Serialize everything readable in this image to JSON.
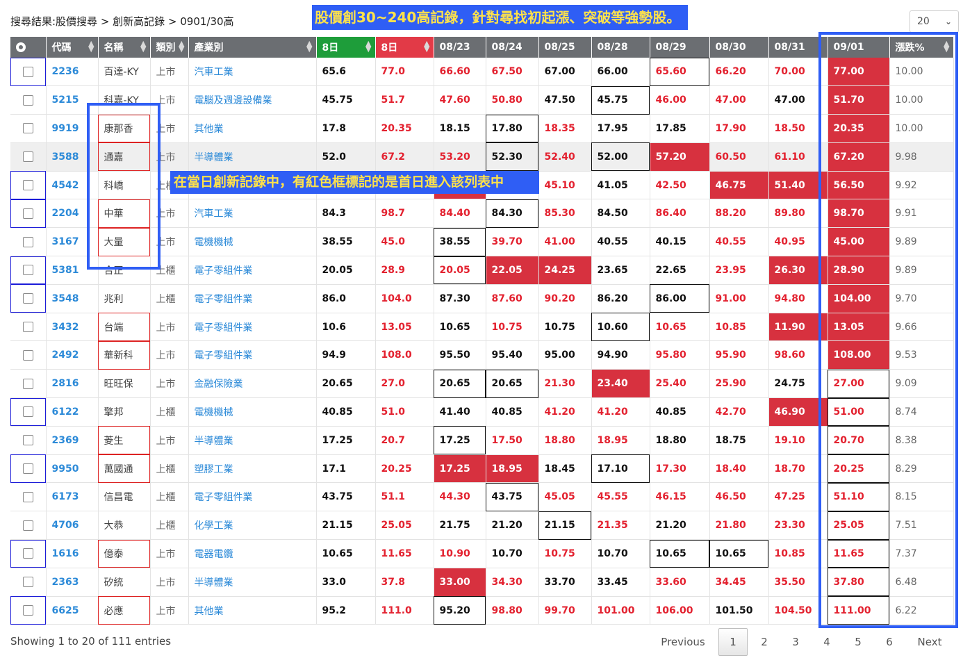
{
  "breadcrumb": "搜尋結果:股價搜尋 > 創新高記錄 > 0901/30高",
  "banner": "股價創30~240高記錄，針對尋找初起漲、突破等強勢股。",
  "callout": "在當日創新記錄中，有紅色框標記的是首日進入該列表中",
  "page_size": "20",
  "headers": [
    "代碼",
    "名稱",
    "類別",
    "產業別",
    "8日",
    "8日",
    "08/23",
    "08/24",
    "08/25",
    "08/28",
    "08/29",
    "08/30",
    "08/31",
    "09/01",
    "漲跌%"
  ],
  "rows": [
    {
      "code": "2236",
      "name": "百達-KY",
      "mkt": "上市",
      "ind": "汽車工業",
      "low": "65.6",
      "high": "77.0",
      "d": [
        "66.60",
        "67.50",
        "67.00",
        "66.00",
        "65.60",
        "66.20",
        "70.00",
        "77.00"
      ],
      "pct": "10.00"
    },
    {
      "code": "5215",
      "name": "科嘉-KY",
      "mkt": "上市",
      "ind": "電腦及週邊設備業",
      "low": "45.75",
      "high": "51.7",
      "d": [
        "47.60",
        "50.80",
        "47.50",
        "45.75",
        "46.00",
        "47.00",
        "47.00",
        "51.70"
      ],
      "pct": "10.00"
    },
    {
      "code": "9919",
      "name": "康那香",
      "mkt": "上市",
      "ind": "其他業",
      "low": "17.8",
      "high": "20.35",
      "d": [
        "18.15",
        "17.80",
        "18.35",
        "17.95",
        "17.85",
        "17.90",
        "18.50",
        "20.35"
      ],
      "pct": "10.00"
    },
    {
      "code": "3588",
      "name": "通嘉",
      "mkt": "上市",
      "ind": "半導體業",
      "low": "52.0",
      "high": "67.2",
      "d": [
        "53.20",
        "52.30",
        "52.40",
        "52.00",
        "57.20",
        "60.50",
        "61.10",
        "67.20"
      ],
      "pct": "9.98"
    },
    {
      "code": "4542",
      "name": "科嶠",
      "mkt": "上櫃",
      "ind": "",
      "low": "",
      "high": "",
      "d": [
        "",
        "",
        "45.10",
        "41.05",
        "42.50",
        "46.75",
        "51.40",
        "56.50"
      ],
      "pct": "9.92"
    },
    {
      "code": "2204",
      "name": "中華",
      "mkt": "上市",
      "ind": "汽車工業",
      "low": "84.3",
      "high": "98.7",
      "d": [
        "84.40",
        "84.30",
        "85.30",
        "84.50",
        "86.40",
        "88.20",
        "89.80",
        "98.70"
      ],
      "pct": "9.91"
    },
    {
      "code": "3167",
      "name": "大量",
      "mkt": "上市",
      "ind": "電機機械",
      "low": "38.55",
      "high": "45.0",
      "d": [
        "38.55",
        "39.70",
        "41.00",
        "40.55",
        "40.15",
        "40.55",
        "40.95",
        "45.00"
      ],
      "pct": "9.89"
    },
    {
      "code": "5381",
      "name": "合正",
      "mkt": "上櫃",
      "ind": "電子零組件業",
      "low": "20.05",
      "high": "28.9",
      "d": [
        "20.05",
        "22.05",
        "24.25",
        "23.65",
        "22.65",
        "23.95",
        "26.30",
        "28.90"
      ],
      "pct": "9.89"
    },
    {
      "code": "3548",
      "name": "兆利",
      "mkt": "上櫃",
      "ind": "電子零組件業",
      "low": "86.0",
      "high": "104.0",
      "d": [
        "87.30",
        "87.60",
        "90.20",
        "86.20",
        "86.00",
        "91.00",
        "94.80",
        "104.00"
      ],
      "pct": "9.70"
    },
    {
      "code": "3432",
      "name": "台端",
      "mkt": "上市",
      "ind": "電子零組件業",
      "low": "10.6",
      "high": "13.05",
      "d": [
        "10.65",
        "10.75",
        "10.75",
        "10.60",
        "10.65",
        "10.85",
        "11.90",
        "13.05"
      ],
      "pct": "9.66"
    },
    {
      "code": "2492",
      "name": "華新科",
      "mkt": "上市",
      "ind": "電子零組件業",
      "low": "94.9",
      "high": "108.0",
      "d": [
        "95.50",
        "95.40",
        "95.00",
        "94.90",
        "95.80",
        "95.90",
        "98.60",
        "108.00"
      ],
      "pct": "9.53"
    },
    {
      "code": "2816",
      "name": "旺旺保",
      "mkt": "上市",
      "ind": "金融保險業",
      "low": "20.65",
      "high": "27.0",
      "d": [
        "20.65",
        "20.65",
        "21.30",
        "23.40",
        "25.40",
        "25.90",
        "24.75",
        "27.00"
      ],
      "pct": "9.09"
    },
    {
      "code": "6122",
      "name": "擎邦",
      "mkt": "上櫃",
      "ind": "電機機械",
      "low": "40.85",
      "high": "51.0",
      "d": [
        "41.40",
        "40.85",
        "41.20",
        "41.20",
        "40.85",
        "42.70",
        "46.90",
        "51.00"
      ],
      "pct": "8.74"
    },
    {
      "code": "2369",
      "name": "菱生",
      "mkt": "上市",
      "ind": "半導體業",
      "low": "17.25",
      "high": "20.7",
      "d": [
        "17.25",
        "17.50",
        "18.80",
        "18.95",
        "18.80",
        "18.75",
        "19.10",
        "20.70"
      ],
      "pct": "8.38"
    },
    {
      "code": "9950",
      "name": "萬國通",
      "mkt": "上櫃",
      "ind": "塑膠工業",
      "low": "17.1",
      "high": "20.25",
      "d": [
        "17.25",
        "18.95",
        "18.45",
        "17.10",
        "17.30",
        "18.40",
        "18.70",
        "20.25"
      ],
      "pct": "8.29"
    },
    {
      "code": "6173",
      "name": "信昌電",
      "mkt": "上櫃",
      "ind": "電子零組件業",
      "low": "43.75",
      "high": "51.1",
      "d": [
        "44.30",
        "43.75",
        "45.05",
        "45.55",
        "46.15",
        "46.50",
        "47.25",
        "51.10"
      ],
      "pct": "8.15"
    },
    {
      "code": "4706",
      "name": "大恭",
      "mkt": "上櫃",
      "ind": "化學工業",
      "low": "21.15",
      "high": "25.05",
      "d": [
        "21.75",
        "21.20",
        "21.15",
        "21.35",
        "21.20",
        "21.80",
        "23.30",
        "25.05"
      ],
      "pct": "7.51"
    },
    {
      "code": "1616",
      "name": "億泰",
      "mkt": "上市",
      "ind": "電器電纜",
      "low": "10.65",
      "high": "11.65",
      "d": [
        "10.90",
        "10.70",
        "10.75",
        "10.70",
        "10.65",
        "10.65",
        "10.85",
        "11.65"
      ],
      "pct": "7.37"
    },
    {
      "code": "2363",
      "name": "矽統",
      "mkt": "上市",
      "ind": "半導體業",
      "low": "33.0",
      "high": "37.8",
      "d": [
        "33.00",
        "34.30",
        "33.70",
        "33.45",
        "33.60",
        "34.45",
        "35.50",
        "37.80"
      ],
      "pct": "6.48"
    },
    {
      "code": "6625",
      "name": "必應",
      "mkt": "上市",
      "ind": "其他業",
      "low": "95.2",
      "high": "111.0",
      "d": [
        "95.20",
        "98.80",
        "99.70",
        "101.00",
        "106.00",
        "101.50",
        "104.50",
        "111.00"
      ],
      "pct": "6.22"
    }
  ],
  "footer": "Showing 1 to 20 of 111 entries",
  "pager": {
    "prev": "Previous",
    "pages": [
      "1",
      "2",
      "3",
      "4",
      "5",
      "6"
    ],
    "next": "Next"
  }
}
